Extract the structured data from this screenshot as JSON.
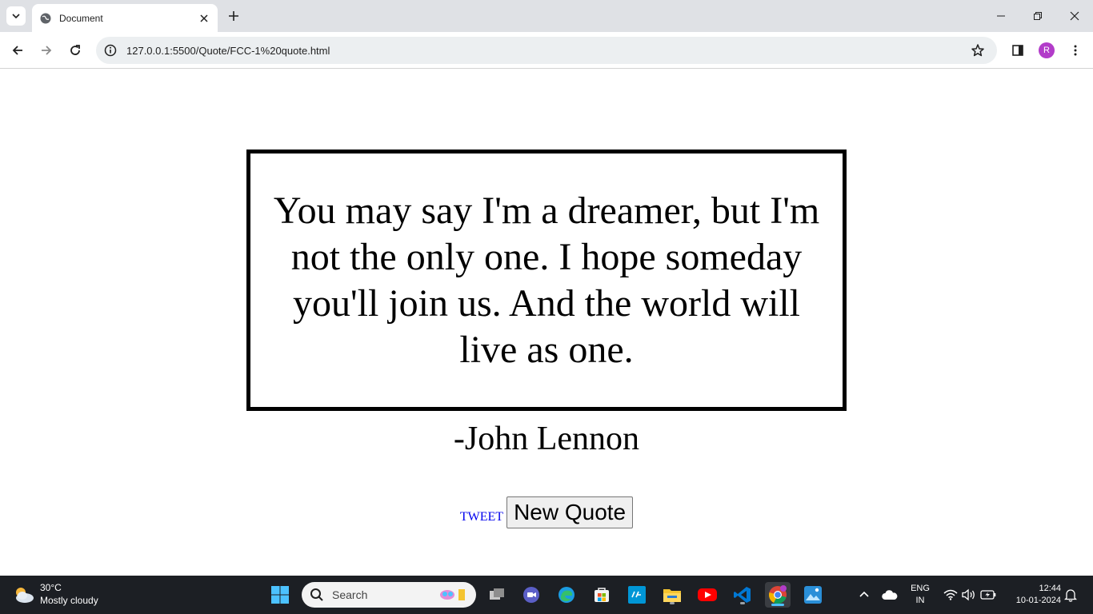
{
  "browser": {
    "tab_title": "Document",
    "url": "127.0.0.1:5500/Quote/FCC-1%20quote.html",
    "profile_initial": "R"
  },
  "quote": {
    "text": "You may say I'm a dreamer, but I'm not the only one. I hope someday you'll join us. And the world will live as one.",
    "author": "-John Lennon"
  },
  "actions": {
    "tweet_label": "TWEET",
    "new_quote_label": "New Quote"
  },
  "taskbar": {
    "weather_temp": "30°C",
    "weather_condition": "Mostly cloudy",
    "search_label": "Search",
    "lang_line1": "ENG",
    "lang_line2": "IN",
    "time": "12:44",
    "date": "10-01-2024"
  },
  "colors": {
    "tab_strip": "#dfe1e5",
    "link": "#0000ee",
    "taskbar": "#1c1f24",
    "avatar": "#b23cc9"
  }
}
